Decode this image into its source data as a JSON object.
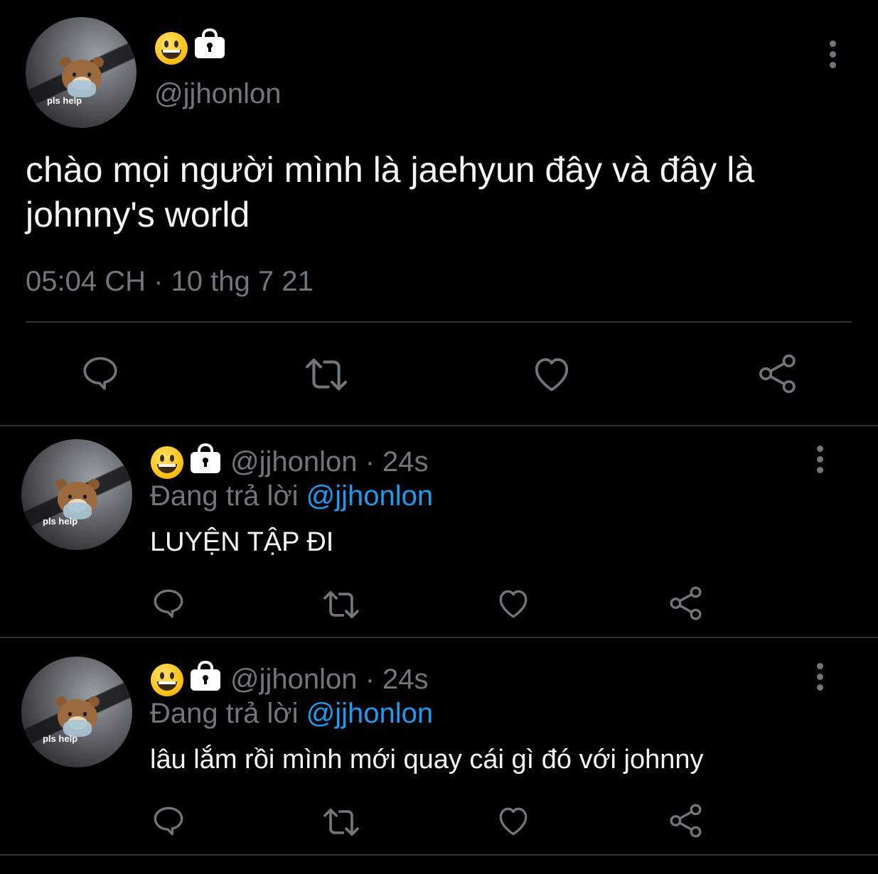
{
  "main_tweet": {
    "avatar_text": "pls help",
    "handle": "@jjhonlon",
    "text": "chào mọi người mình là jaehyun đây và đây là johnny's world",
    "timestamp": "05:04 CH · 10 thg 7 21"
  },
  "replies": [
    {
      "avatar_text": "pls help",
      "handle": "@jjhonlon",
      "time": "· 24s",
      "replying_prefix": "Đang trả lời",
      "replying_to": "@jjhonlon",
      "text": "LUYỆN TẬP ĐI"
    },
    {
      "avatar_text": "pls help",
      "handle": "@jjhonlon",
      "time": "· 24s",
      "replying_prefix": "Đang trả lời",
      "replying_to": "@jjhonlon",
      "text": "lâu lắm rồi mình mới quay cái gì đó với johnny"
    }
  ],
  "icons": {
    "display_name_emoji": "grinning-face-icon",
    "protected_badge": "lock-icon",
    "menu": "more-vertical-icon",
    "reply": "reply-icon",
    "retweet": "retweet-icon",
    "like": "heart-icon",
    "share": "share-icon"
  },
  "colors": {
    "background": "#000000",
    "text": "#e7e9ea",
    "secondary": "#71767b",
    "mention": "#1d9bf0",
    "divider": "#2f3336"
  }
}
